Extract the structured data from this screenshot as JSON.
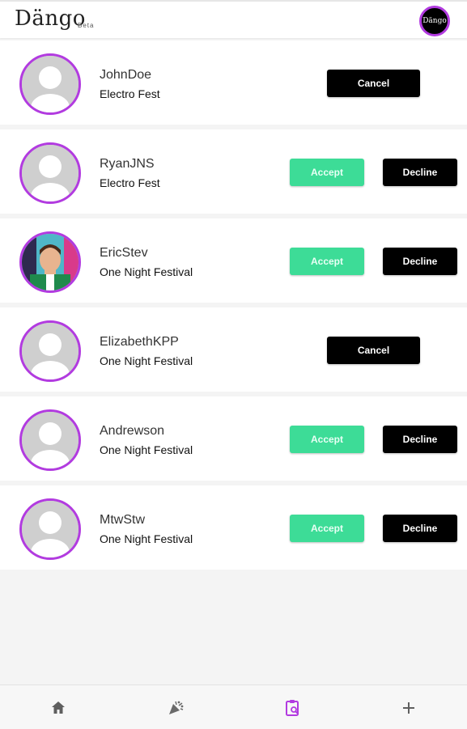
{
  "header": {
    "logo": "Dängo",
    "beta_label": "Beta",
    "avatar_text": "Dängo"
  },
  "colors": {
    "accent_purple": "#b23be0",
    "accept_green": "#3ddc97",
    "button_black": "#000000"
  },
  "requests": [
    {
      "username": "JohnDoe",
      "event": "Electro Fest",
      "type": "outgoing",
      "cancel_label": "Cancel",
      "avatar": "default-avatar-icon"
    },
    {
      "username": "RyanJNS",
      "event": "Electro Fest",
      "type": "incoming",
      "accept_label": "Accept",
      "decline_label": "Decline",
      "avatar": "default-avatar-icon"
    },
    {
      "username": "EricStev",
      "event": "One Night Festival",
      "type": "incoming",
      "accept_label": "Accept",
      "decline_label": "Decline",
      "avatar": "profile-photo"
    },
    {
      "username": "ElizabethKPP",
      "event": "One Night Festival",
      "type": "outgoing",
      "cancel_label": "Cancel",
      "avatar": "default-avatar-icon"
    },
    {
      "username": "Andrewson",
      "event": "One Night Festival",
      "type": "incoming",
      "accept_label": "Accept",
      "decline_label": "Decline",
      "avatar": "default-avatar-icon"
    },
    {
      "username": "MtwStw",
      "event": "One Night Festival",
      "type": "incoming",
      "accept_label": "Accept",
      "decline_label": "Decline",
      "avatar": "default-avatar-icon"
    }
  ],
  "bottom_nav": [
    {
      "icon": "home-icon",
      "active": false
    },
    {
      "icon": "party-popper-icon",
      "active": false
    },
    {
      "icon": "clipboard-search-icon",
      "active": true
    },
    {
      "icon": "plus-icon",
      "active": false
    }
  ]
}
